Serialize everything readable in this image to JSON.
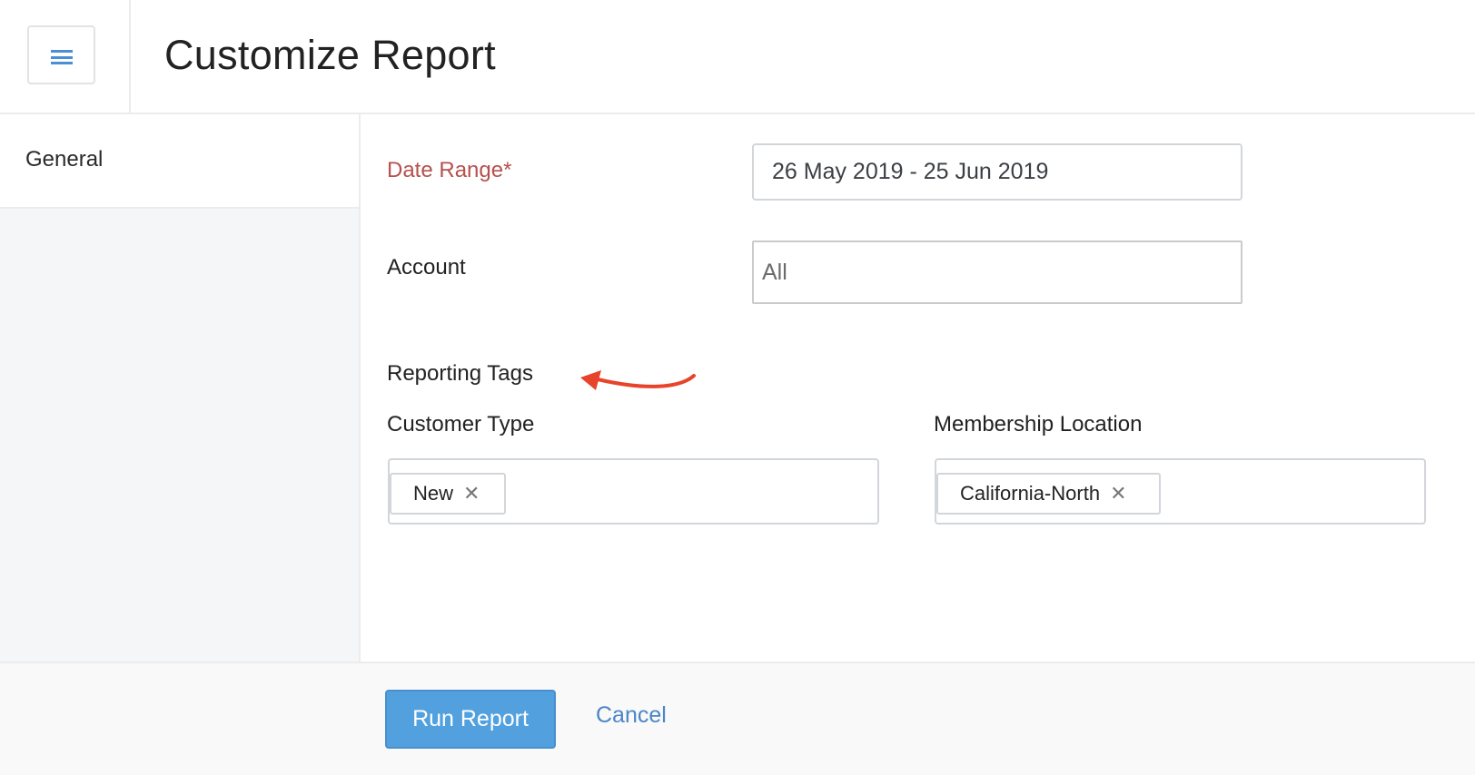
{
  "header": {
    "menu_icon": "hamburger-menu-icon",
    "title": "Customize Report"
  },
  "sidebar": {
    "items": [
      {
        "label": "General",
        "active": true
      }
    ]
  },
  "form": {
    "date_range": {
      "label": "Date Range*",
      "value": "26 May 2019 - 25 Jun 2019",
      "label_color": "#b5514e"
    },
    "account": {
      "label": "Account",
      "value": "All"
    },
    "reporting_tags": {
      "heading": "Reporting Tags",
      "annotation": "red-arrow-pointing-left",
      "fields": [
        {
          "label": "Customer Type",
          "tags": [
            "New"
          ]
        },
        {
          "label": "Membership Location",
          "tags": [
            "California-North"
          ]
        }
      ]
    },
    "remove_tag_glyph": "✕"
  },
  "footer": {
    "run_report_label": "Run Report",
    "cancel_label": "Cancel",
    "primary_color": "#52a1de"
  }
}
